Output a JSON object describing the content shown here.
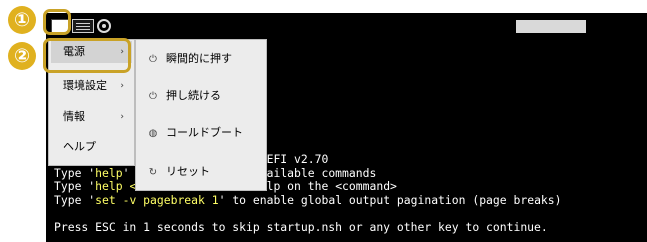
{
  "colors": {
    "callout": "#c9a227",
    "badge": "#e0b11f",
    "console_highlight": "#ffff66"
  },
  "toolbar": {
    "icons": [
      "power-menu-icon",
      "keyboard-icon",
      "info-icon"
    ]
  },
  "menu": {
    "items": [
      {
        "label": "電源",
        "has_submenu": true
      },
      {
        "label": "環境設定",
        "has_submenu": true
      },
      {
        "label": "情報",
        "has_submenu": true
      },
      {
        "label": "ヘルプ",
        "has_submenu": false
      }
    ],
    "arrow": "›"
  },
  "submenu": {
    "items": [
      {
        "label": "瞬間的に押す",
        "icon": "power-icon"
      },
      {
        "label": "押し続ける",
        "icon": "power-hold-icon"
      },
      {
        "label": "コールドブート",
        "icon": "cold-boot-icon"
      },
      {
        "label": "リセット",
        "icon": "reset-icon"
      }
    ]
  },
  "callouts": [
    "①",
    "②"
  ],
  "console": {
    "line1": "HTC Embedded UEFI Shell v2.2. UEFI v2.70",
    "line2_a": "Type '",
    "line2_b": "help",
    "line2_c": "' to get a list of available commands",
    "line3_a": "Type '",
    "line3_b": "help <command> -b",
    "line3_c": "' for help on the <command>",
    "line4_a": "Type '",
    "line4_b": "set -v pagebreak 1",
    "line4_c": "' to enable global output pagination (page breaks)",
    "line5": "Press ESC in 1 seconds to skip startup.nsh or any other key to continue."
  }
}
